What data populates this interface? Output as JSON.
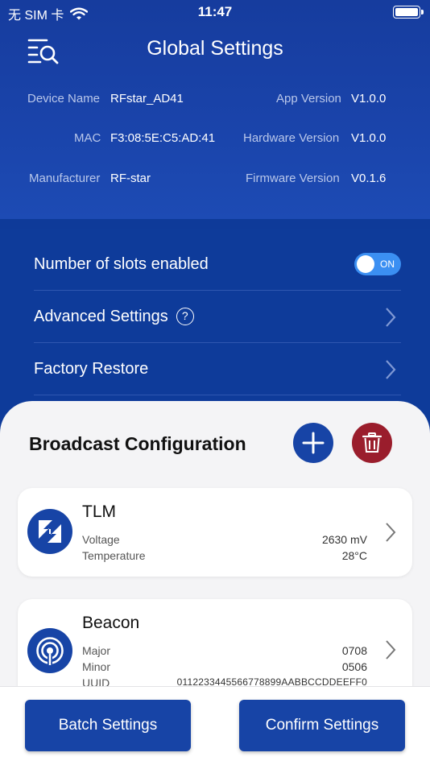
{
  "status_bar": {
    "carrier": "无 SIM 卡",
    "time": "11:47",
    "icons": [
      "wifi-icon",
      "battery-icon"
    ]
  },
  "header": {
    "title": "Global Settings",
    "menu_icon": "list-search-icon"
  },
  "device_info": {
    "device_name_label": "Device Name",
    "device_name": "RFstar_AD41",
    "mac_label": "MAC",
    "mac": "F3:08:5E:C5:AD:41",
    "manufacturer_label": "Manufacturer",
    "manufacturer": "RF-star",
    "app_version_label": "App Version",
    "app_version": "V1.0.0",
    "hardware_version_label": "Hardware Version",
    "hardware_version": "V1.0.0",
    "firmware_version_label": "Firmware Version",
    "firmware_version": "V0.1.6"
  },
  "settings": {
    "slots_label": "Number of slots enabled",
    "slots_toggle": "ON",
    "slots_enabled": true,
    "advanced_label": "Advanced Settings",
    "advanced_help": "?",
    "factory_label": "Factory Restore"
  },
  "broadcast": {
    "title": "Broadcast Configuration",
    "add_icon": "plus-icon",
    "delete_icon": "trash-icon",
    "cards": [
      {
        "title": "TLM",
        "icon": "tlm-icon",
        "rows": [
          {
            "label": "Voltage",
            "value": "2630 mV"
          },
          {
            "label": "Temperature",
            "value": "28°C"
          }
        ]
      },
      {
        "title": "Beacon",
        "icon": "beacon-signal-icon",
        "rows": [
          {
            "label": "Major",
            "value": "0708"
          },
          {
            "label": "Minor",
            "value": "0506"
          },
          {
            "label": "UUID",
            "value": "0112233445566778899AABBCCDDEEFF0"
          }
        ]
      }
    ]
  },
  "actions": {
    "batch_label": "Batch Settings",
    "confirm_label": "Confirm Settings"
  },
  "colors": {
    "primary_blue": "#1744a6",
    "header_blue": "#163c9e",
    "delete_red": "#9a1d2c",
    "toggle_blue": "#3b8ff2"
  }
}
